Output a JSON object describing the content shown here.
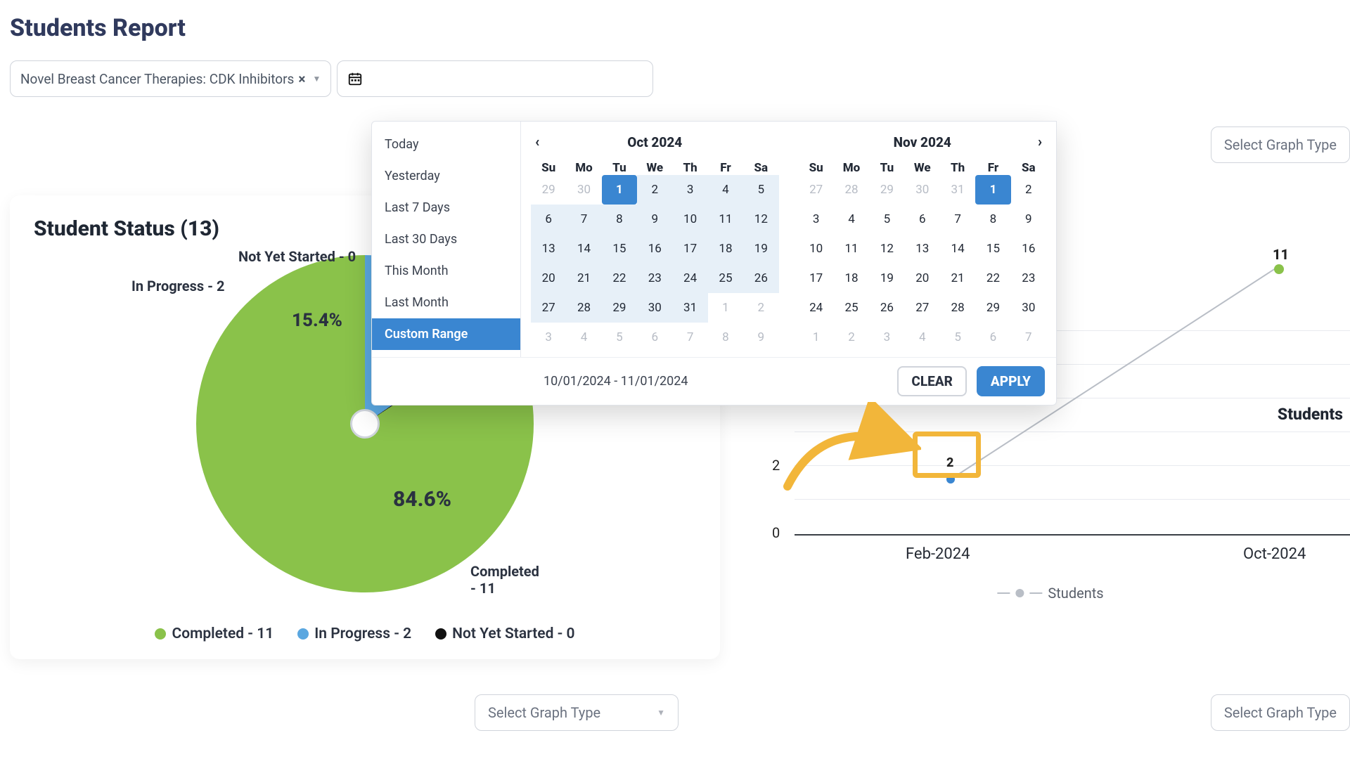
{
  "header": {
    "title": "Students Report"
  },
  "filters": {
    "course": "Novel Breast Cancer Therapies: CDK Inhibitors",
    "graph_type_placeholder": "Select Graph Type"
  },
  "panel": {
    "title": "Student Status (13)"
  },
  "pie_labels": {
    "not_started": "Not Yet Started - 0",
    "in_progress": "In Progress - 2",
    "completed": "Completed - 11",
    "pct_in_progress": "15.4%",
    "pct_completed": "84.6%"
  },
  "legend": {
    "completed": "Completed - 11",
    "in_progress": "In Progress - 2",
    "not_started": "Not Yet Started - 0"
  },
  "drp": {
    "ranges": [
      "Today",
      "Yesterday",
      "Last 7 Days",
      "Last 30 Days",
      "This Month",
      "Last Month",
      "Custom Range"
    ],
    "active_range_index": 6,
    "month1": "Oct 2024",
    "month2": "Nov 2024",
    "dow": [
      "Su",
      "Mo",
      "Tu",
      "We",
      "Th",
      "Fr",
      "Sa"
    ],
    "range_text": "10/01/2024 - 11/01/2024",
    "clear": "CLEAR",
    "apply": "APPLY",
    "oct": {
      "lead_off": [
        29,
        30
      ],
      "sel_start": 1,
      "in_range_first_row": [
        2,
        3,
        4,
        5
      ],
      "rows": [
        [
          6,
          7,
          8,
          9,
          10,
          11,
          12
        ],
        [
          13,
          14,
          15,
          16,
          17,
          18,
          19
        ],
        [
          20,
          21,
          22,
          23,
          24,
          25,
          26
        ]
      ],
      "last_row_in": [
        27,
        28,
        29,
        30,
        31
      ],
      "last_row_off": [
        1,
        2
      ],
      "trail_off": [
        3,
        4,
        5,
        6,
        7,
        8,
        9
      ]
    },
    "nov": {
      "lead_off": [
        27,
        28,
        29,
        30,
        31
      ],
      "sel_end": 1,
      "first_row_tail": [
        2
      ],
      "rows": [
        [
          3,
          4,
          5,
          6,
          7,
          8,
          9
        ],
        [
          10,
          11,
          12,
          13,
          14,
          15,
          16
        ],
        [
          17,
          18,
          19,
          20,
          21,
          22,
          23
        ],
        [
          24,
          25,
          26,
          27,
          28,
          29,
          30
        ]
      ],
      "trail_off": [
        1,
        2,
        3,
        4,
        5,
        6,
        7
      ]
    }
  },
  "chart": {
    "y2": "2",
    "y0": "0",
    "blue_lbl": "2",
    "green_lbl": "11",
    "ylabel": "Students",
    "x_feb": "Feb-2024",
    "x_oct": "Oct-2024",
    "legend": "Students"
  },
  "chart_data": {
    "type": "line",
    "series": [
      {
        "name": "Students",
        "x": [
          "Feb-2024",
          "Oct-2024"
        ],
        "y": [
          2,
          11
        ]
      }
    ],
    "ylabel": "Students",
    "ylim": [
      0,
      11
    ]
  },
  "colors": {
    "green": "#8ac24a",
    "blue": "#5aa7e0",
    "accent": "#3a86d1",
    "annotate": "#f2b63a"
  }
}
